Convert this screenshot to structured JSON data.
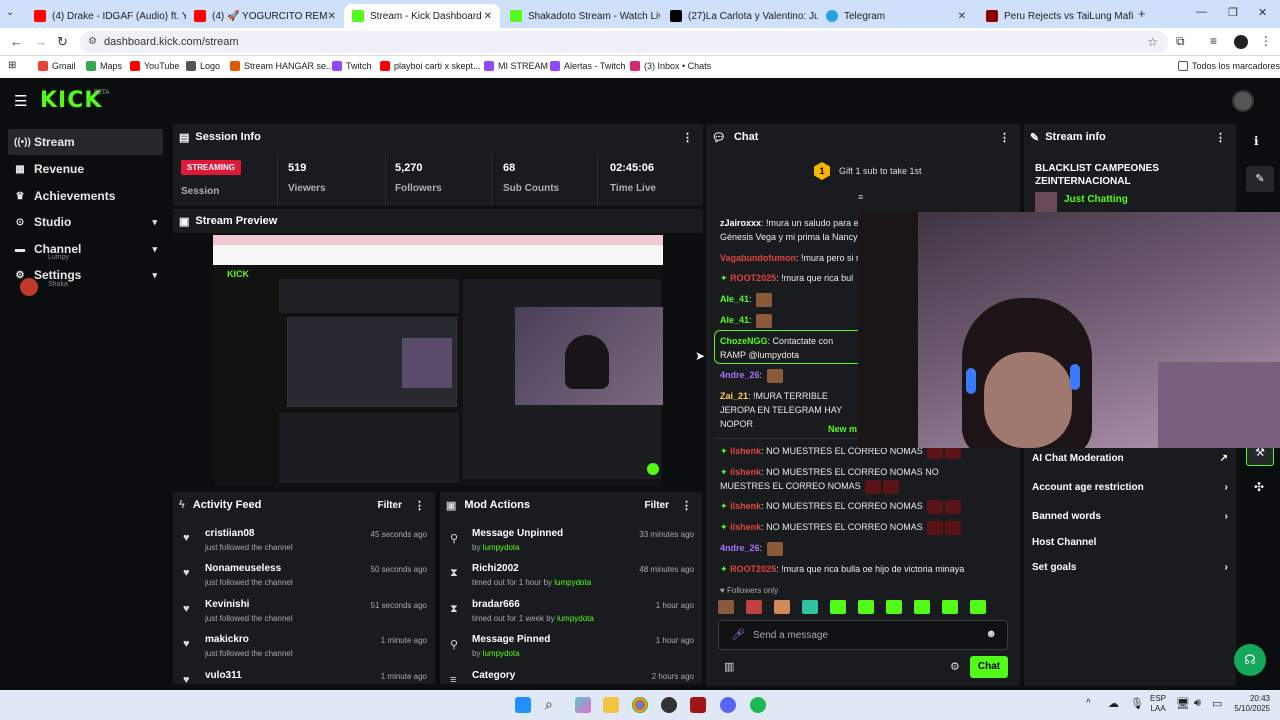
{
  "browser": {
    "tabs": [
      {
        "title": "(4) Drake - IDGAF (Audio) ft. Ye",
        "color": "#ff0000"
      },
      {
        "title": "(4) 🚀 YOGURCITO REM",
        "color": "#ff0000"
      },
      {
        "title": "Stream - Kick Dashboard",
        "color": "#53fc18"
      },
      {
        "title": "Shakadoto Stream - Watch Live",
        "color": "#53fc18"
      },
      {
        "title": "(27)La Carlota y Valentino: Jun",
        "color": "#000000"
      },
      {
        "title": "Telegram",
        "color": "#2aa3e0"
      },
      {
        "title": "Peru Rejects vs TaiLung Mafia n",
        "color": "#8b0000"
      }
    ],
    "url": "dashboard.kick.com/stream",
    "bookmarks": [
      "Gmail",
      "Maps",
      "YouTube",
      "Logo",
      "Stream HANGAR se...",
      "Twitch",
      "playboi carti x skept...",
      "MI STREAM",
      "Alertas - Twitch",
      "(3) Inbox • Chats"
    ],
    "all_bookmarks": "Todos los marcadores"
  },
  "kick": {
    "logo": "KICK",
    "beta": "BETA",
    "nav": [
      {
        "label": "Stream",
        "icon": "broadcast-icon"
      },
      {
        "label": "Revenue",
        "icon": "revenue-icon"
      },
      {
        "label": "Achievements",
        "icon": "trophy-icon"
      },
      {
        "label": "Studio",
        "icon": "studio-icon"
      },
      {
        "label": "Channel",
        "icon": "channel-icon"
      },
      {
        "label": "Settings",
        "icon": "gear-icon"
      }
    ],
    "overlay_user": "Lumpy",
    "overlay_user2": "Shaka"
  },
  "session": {
    "title": "Session Info",
    "status": "STREAMING",
    "session_label": "Session",
    "viewers": "519",
    "viewers_label": "Viewers",
    "followers": "5,270",
    "followers_label": "Followers",
    "subs": "68",
    "subs_label": "Sub Counts",
    "time": "02:45:06",
    "time_label": "Time Live"
  },
  "preview": {
    "title": "Stream Preview"
  },
  "activity": {
    "title": "Activity Feed",
    "filter": "Filter",
    "items": [
      {
        "name": "cristiian08",
        "action": "just followed the channel",
        "time": "45 seconds ago"
      },
      {
        "name": "Nonameuseless",
        "action": "just followed the channel",
        "time": "50 seconds ago"
      },
      {
        "name": "Kevinishi",
        "action": "just followed the channel",
        "time": "51 seconds ago"
      },
      {
        "name": "makickro",
        "action": "just followed the channel",
        "time": "1 minute ago"
      },
      {
        "name": "vulo311",
        "action": "",
        "time": "1 minute ago"
      }
    ]
  },
  "mod": {
    "title": "Mod Actions",
    "filter": "Filter",
    "items": [
      {
        "name": "Message Unpinned",
        "pre": "by ",
        "user": "lumpydota",
        "time": "33 minutes ago"
      },
      {
        "name": "Richi2002",
        "pre": "timed out for 1 hour by ",
        "user": "lumpydota",
        "time": "48 minutes ago"
      },
      {
        "name": "bradar666",
        "pre": "timed out for 1 week by ",
        "user": "lumpydota",
        "time": "1 hour ago"
      },
      {
        "name": "Message Pinned",
        "pre": "by ",
        "user": "lumpydota",
        "time": "1 hour ago"
      },
      {
        "name": "Category",
        "pre": "",
        "user": "",
        "time": "2 hours ago"
      }
    ]
  },
  "chat": {
    "title": "Chat",
    "gift_count": "1",
    "gift_text": "Gift 1 sub to take 1st",
    "new_messages": "New m",
    "followers_only": "Followers only",
    "input_placeholder": "Send a message",
    "send": "Chat",
    "messages": [
      {
        "user": "zJairoxxx",
        "color": "#ffffff",
        "text": "!mura un saludo para e Génesis Vega y mi prima la Nancy"
      },
      {
        "user": "Vagabundofumon",
        "color": "#e0453c",
        "text": "!mura pero si r"
      },
      {
        "user": "ROOT2025",
        "color": "#e0453c",
        "text": "!mura que rica bul"
      },
      {
        "user": "Ale_41",
        "color": "#53fc18",
        "text": ""
      },
      {
        "user": "Ale_41",
        "color": "#53fc18",
        "text": ""
      },
      {
        "user": "ChozeNGG",
        "color": "#53fc18",
        "text": "Contactate con RAMP @lumpydota"
      },
      {
        "user": "4ndre_26",
        "color": "#a970ff",
        "text": ""
      },
      {
        "user": "Zai_21",
        "color": "#ffd24a",
        "text": "!MURA TERRIBLE JEROPA EN TELEGRAM HAY NOPOR"
      },
      {
        "user": "ilshenk",
        "color": "#e0453c",
        "text": "NO MUESTRES EL CORREO NOMAS"
      },
      {
        "user": "ilshenk",
        "color": "#e0453c",
        "text": "NO MUESTRES EL CORREO NOMAS NO MUESTRES EL CORREO NOMAS"
      },
      {
        "user": "ilshenk",
        "color": "#e0453c",
        "text": "NO MUESTRES EL CORREO NOMAS"
      },
      {
        "user": "ilshenk",
        "color": "#e0453c",
        "text": "NO MUESTRES EL CORREO NOMAS"
      },
      {
        "user": "4ndre_26",
        "color": "#a970ff",
        "text": ""
      },
      {
        "user": "ROOT2025",
        "color": "#e0453c",
        "text": "!mura que rica bulla oe hijo de victoria minaya"
      }
    ]
  },
  "stream_info": {
    "title": "Stream info",
    "stream_title": "BLACKLIST CAMPEONES ZEINTERNACIONAL",
    "category": "Just Chatting",
    "menu": [
      {
        "label": "AI Chat Moderation"
      },
      {
        "label": "Account age restriction"
      },
      {
        "label": "Banned words"
      },
      {
        "label": "Host Channel"
      },
      {
        "label": "Set goals"
      }
    ]
  },
  "taskbar": {
    "lang": "ESP",
    "region": "LAA",
    "time": "20:43",
    "date": "5/10/2025"
  }
}
